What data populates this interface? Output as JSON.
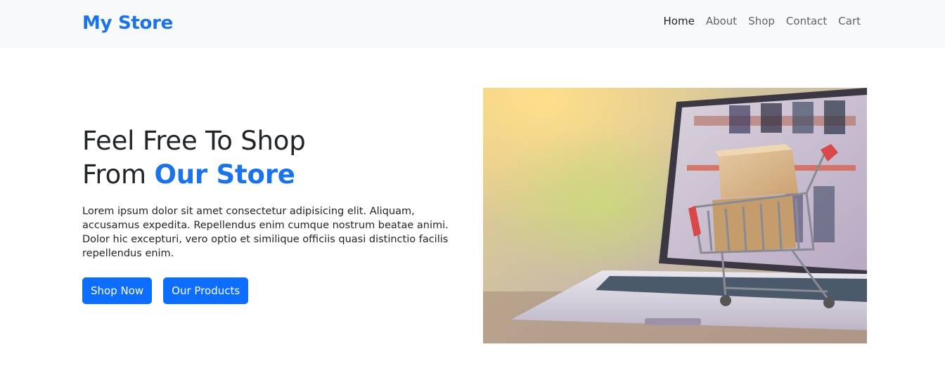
{
  "navbar": {
    "brand": "My Store",
    "links": [
      {
        "label": "Home",
        "active": true
      },
      {
        "label": "About",
        "active": false
      },
      {
        "label": "Shop",
        "active": false
      },
      {
        "label": "Contact",
        "active": false
      },
      {
        "label": "Cart",
        "active": false
      }
    ]
  },
  "hero": {
    "title_line1": "Feel Free To Shop",
    "title_line2_prefix": "From ",
    "title_line2_accent": "Our Store",
    "description": "Lorem ipsum dolor sit amet consectetur adipisicing elit. Aliquam, accusamus expedita. Repellendus enim cumque nostrum beatae animi. Dolor hic excepturi, vero optio et similique officiis quasi distinctio facilis repellendus enim.",
    "buttons": {
      "primary": "Shop Now",
      "secondary": "Our Products"
    },
    "image_icon": "laptop-shopping-cart-image"
  },
  "colors": {
    "brand": "#1a73e8",
    "button": "#0d6efd",
    "navbar_bg": "#f8f9fa"
  }
}
